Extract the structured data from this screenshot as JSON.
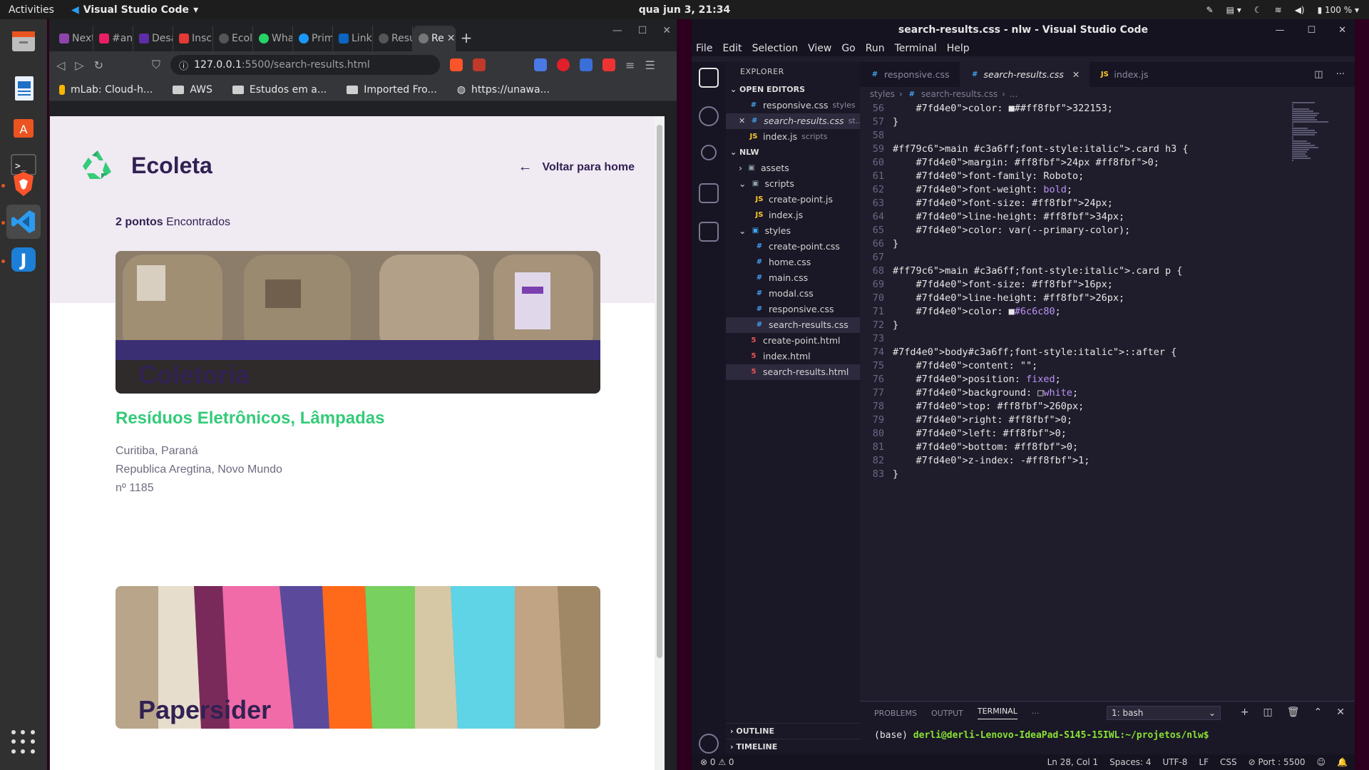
{
  "topbar": {
    "activities": "Activities",
    "app_name": "Visual Studio Code",
    "clock": "qua jun  3, 21:34",
    "battery": "100 %"
  },
  "browser": {
    "tabs": [
      {
        "label": "Next",
        "color": "#8e44ad"
      },
      {
        "label": "#anú",
        "color": "#e91e63"
      },
      {
        "label": "Desa",
        "color": "#5c2ea8"
      },
      {
        "label": "Inscri",
        "color": "#e53935"
      },
      {
        "label": "Ecole",
        "color": "#555555"
      },
      {
        "label": "What",
        "color": "#25d366"
      },
      {
        "label": "Prime",
        "color": "#1a98ff"
      },
      {
        "label": "Linke",
        "color": "#0a66c2"
      },
      {
        "label": "Resul",
        "color": "#555555"
      },
      {
        "label": "Re",
        "color": "#777777"
      }
    ],
    "url_host": "127.0.0.1",
    "url_path": ":5500/search-results.html",
    "bookmarks": [
      "mLab: Cloud-h...",
      "AWS",
      "Estudos em a...",
      "Imported Fro...",
      "https://unawa..."
    ]
  },
  "page": {
    "site_title": "Ecoleta",
    "back_label": "Voltar para home",
    "found_count": "2 pontos",
    "found_label": "Encontrados",
    "cards": [
      {
        "title": "Coletoria",
        "items": "Resíduos Eletrônicos, Lâmpadas",
        "address": [
          "Curitiba, Paraná",
          "Republica Aregtina, Novo Mundo",
          "nº 1185"
        ]
      },
      {
        "title": "Papersider",
        "items": "",
        "address": []
      }
    ],
    "colors": {
      "primary": "#322153",
      "accent": "#34cb79",
      "text": "#6c6c80",
      "hero_bg": "#f0eaf3"
    }
  },
  "vscode": {
    "title": "search-results.css - nlw - Visual Studio Code",
    "menu": [
      "File",
      "Edit",
      "Selection",
      "View",
      "Go",
      "Run",
      "Terminal",
      "Help"
    ],
    "explorer": {
      "heading": "EXPLORER",
      "open_editors_label": "OPEN EDITORS",
      "open_editors": [
        {
          "name": "responsive.css",
          "desc": "styles",
          "type": "css"
        },
        {
          "name": "search-results.css",
          "desc": "st...",
          "type": "css"
        },
        {
          "name": "index.js",
          "desc": "scripts",
          "type": "js"
        }
      ],
      "project_label": "NLW",
      "tree": [
        {
          "name": "assets",
          "type": "dir",
          "indent": 1
        },
        {
          "name": "scripts",
          "type": "dir",
          "indent": 1
        },
        {
          "name": "create-point.js",
          "type": "js",
          "indent": 2
        },
        {
          "name": "index.js",
          "type": "js",
          "indent": 2
        },
        {
          "name": "styles",
          "type": "dir",
          "indent": 1
        },
        {
          "name": "create-point.css",
          "type": "css",
          "indent": 2
        },
        {
          "name": "home.css",
          "type": "css",
          "indent": 2
        },
        {
          "name": "main.css",
          "type": "css",
          "indent": 2
        },
        {
          "name": "modal.css",
          "type": "css",
          "indent": 2
        },
        {
          "name": "responsive.css",
          "type": "css",
          "indent": 2
        },
        {
          "name": "search-results.css",
          "type": "css",
          "indent": 2,
          "selected": true
        },
        {
          "name": "create-point.html",
          "type": "html",
          "indent": 1
        },
        {
          "name": "index.html",
          "type": "html",
          "indent": 1
        },
        {
          "name": "search-results.html",
          "type": "html",
          "indent": 1
        }
      ],
      "outline_label": "OUTLINE",
      "timeline_label": "TIMELINE"
    },
    "editor_tabs": [
      {
        "name": "responsive.css",
        "type": "css"
      },
      {
        "name": "search-results.css",
        "type": "css",
        "active": true
      },
      {
        "name": "index.js",
        "type": "js"
      }
    ],
    "breadcrumb": [
      "styles",
      "search-results.css",
      "..."
    ],
    "code_lines": [
      {
        "n": "56",
        "t": "    color: ■#322153;"
      },
      {
        "n": "57",
        "t": "}"
      },
      {
        "n": "58",
        "t": ""
      },
      {
        "n": "59",
        "t": "main .card h3 {"
      },
      {
        "n": "60",
        "t": "    margin: 24px 0;"
      },
      {
        "n": "61",
        "t": "    font-family: Roboto;"
      },
      {
        "n": "62",
        "t": "    font-weight: bold;"
      },
      {
        "n": "63",
        "t": "    font-size: 24px;"
      },
      {
        "n": "64",
        "t": "    line-height: 34px;"
      },
      {
        "n": "65",
        "t": "    color: var(--primary-color);"
      },
      {
        "n": "66",
        "t": "}"
      },
      {
        "n": "67",
        "t": ""
      },
      {
        "n": "68",
        "t": "main .card p {"
      },
      {
        "n": "69",
        "t": "    font-size: 16px;"
      },
      {
        "n": "70",
        "t": "    line-height: 26px;"
      },
      {
        "n": "71",
        "t": "    color: ■#6c6c80;"
      },
      {
        "n": "72",
        "t": "}"
      },
      {
        "n": "73",
        "t": ""
      },
      {
        "n": "74",
        "t": "body::after {"
      },
      {
        "n": "75",
        "t": "    content: \"\";"
      },
      {
        "n": "76",
        "t": "    position: fixed;"
      },
      {
        "n": "77",
        "t": "    background: □white;"
      },
      {
        "n": "78",
        "t": "    top: 260px;"
      },
      {
        "n": "79",
        "t": "    right: 0;"
      },
      {
        "n": "80",
        "t": "    left: 0;"
      },
      {
        "n": "81",
        "t": "    bottom: 0;"
      },
      {
        "n": "82",
        "t": "    z-index: -1;"
      },
      {
        "n": "83",
        "t": "}"
      }
    ],
    "panel": {
      "tabs": [
        "PROBLEMS",
        "OUTPUT",
        "TERMINAL",
        "···"
      ],
      "active_tab": "TERMINAL",
      "shell": "1: bash",
      "prompt_env": "(base)",
      "prompt_user": "derli@derli-Lenovo-IdeaPad-S145-15IWL:~/projetos/nlw$"
    },
    "status": {
      "problems": "⊗ 0 ⚠ 0",
      "position": "Ln 28, Col 1",
      "spaces": "Spaces: 4",
      "encoding": "UTF-8",
      "eol": "LF",
      "language": "CSS",
      "port": "Port : 5500"
    }
  }
}
